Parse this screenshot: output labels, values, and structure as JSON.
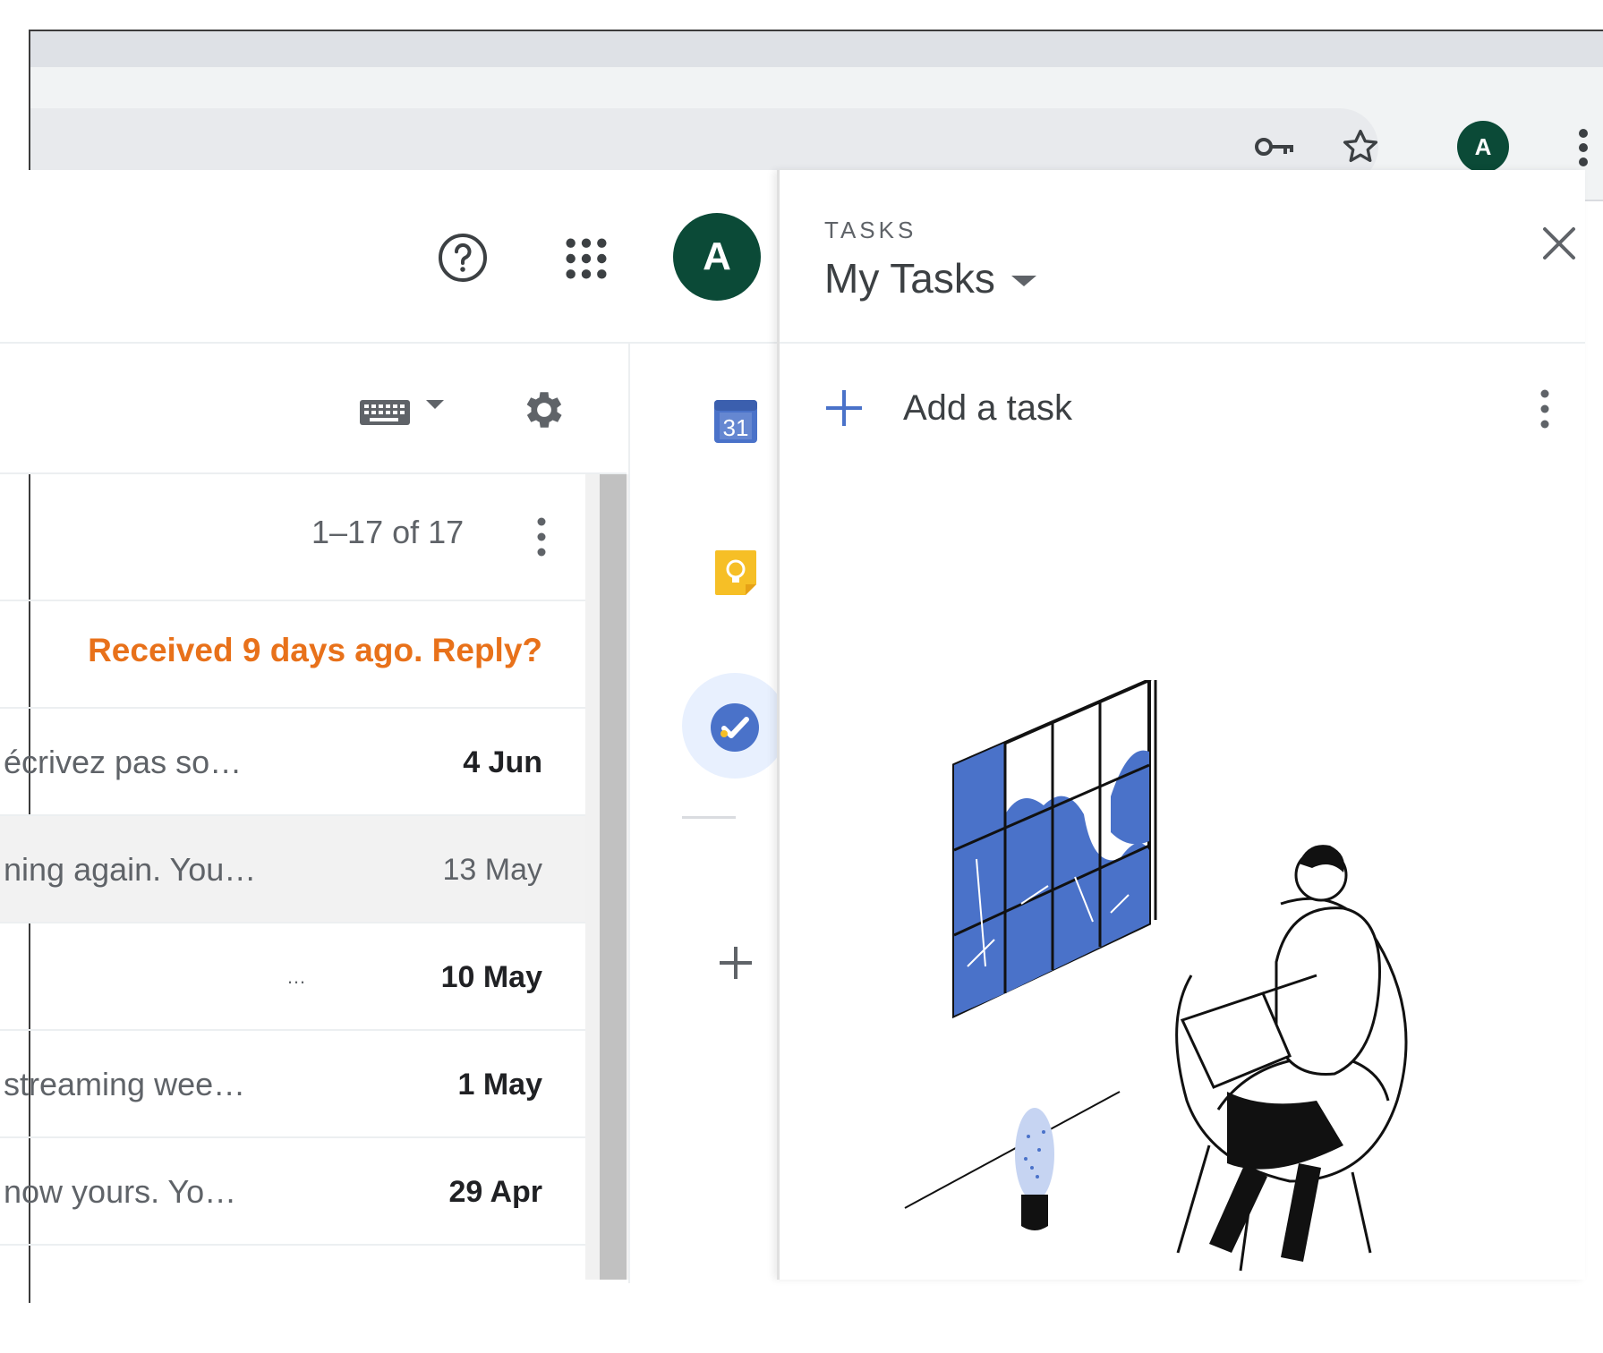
{
  "browser": {
    "profile_initial": "A"
  },
  "gmail": {
    "account_initial": "A",
    "pager": "1–17 of 17",
    "nudge": "Received 9 days ago. Reply?",
    "rows": [
      {
        "snippet": "écrivez pas so…",
        "date": "4 Jun",
        "state": "unread"
      },
      {
        "snippet": "ning again. You…",
        "date": "13 May",
        "state": "read"
      },
      {
        "snippet": "…",
        "date": "10 May",
        "state": "unread"
      },
      {
        "snippet": "streaming wee…",
        "date": "1 May",
        "state": "unread"
      },
      {
        "snippet": "now yours. Yo…",
        "date": "29 Apr",
        "state": "unread"
      }
    ]
  },
  "side_rail": {
    "calendar_day": "31"
  },
  "tasks_panel": {
    "kicker": "TASKS",
    "list_name": "My Tasks",
    "add_label": "Add a task"
  },
  "colors": {
    "nudge": "#e8711a",
    "avatar": "#0b4a37",
    "google_blue": "#4a72c9",
    "keep_yellow": "#f6bf26"
  }
}
